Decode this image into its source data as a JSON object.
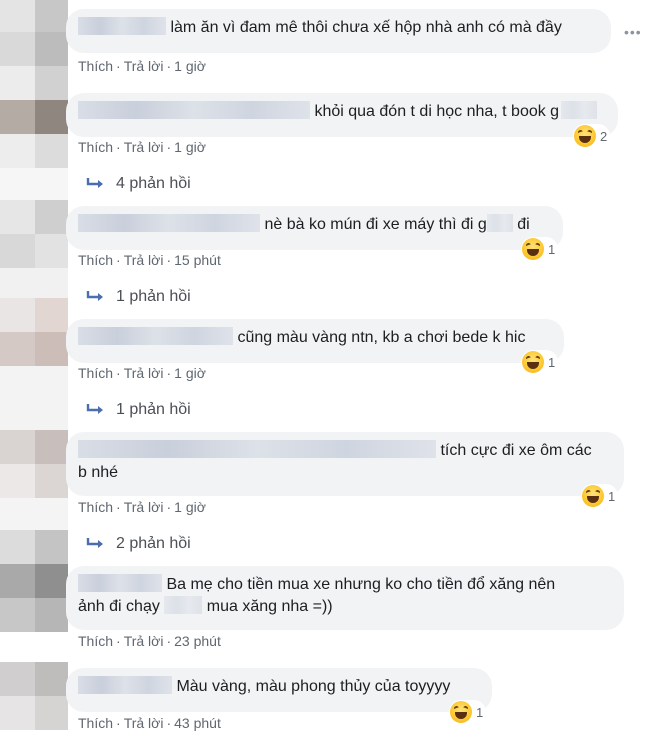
{
  "comments": [
    {
      "text": "làm ăn vì đam mê thôi chưa xế hộp nhà anh có mà đầy",
      "like": "Thích",
      "reply": "Trả lời",
      "time": "1 giờ"
    },
    {
      "text": "khỏi qua đón t di học nha, t book g",
      "like": "Thích",
      "reply": "Trả lời",
      "time": "1 giờ",
      "reactions": "2",
      "replies": "4 phản hồi"
    },
    {
      "text_a": "nè bà ko mún đi xe máy thì đi g",
      "text_b": "đi",
      "like": "Thích",
      "reply": "Trả lời",
      "time": "15 phút",
      "reactions": "1",
      "replies": "1 phản hồi"
    },
    {
      "text": "cũng màu vàng ntn, kb a chơi bede k hic",
      "like": "Thích",
      "reply": "Trả lời",
      "time": "1 giờ",
      "reactions": "1",
      "replies": "1 phản hồi"
    },
    {
      "text_line1": "tích cực đi xe ôm các",
      "text_line2": "b nhé",
      "like": "Thích",
      "reply": "Trả lời",
      "time": "1 giờ",
      "reactions": "1",
      "replies": "2 phản hồi"
    },
    {
      "text_line1": "Ba mẹ cho tiền mua xe nhưng ko cho tiền đổ xăng nên",
      "text_line2a": "ảnh đi chạy",
      "text_line2b": "mua xăng nha =))",
      "like": "Thích",
      "reply": "Trả lời",
      "time": "23 phút"
    },
    {
      "text": "Màu vàng, màu phong thủy của toyyyy",
      "like": "Thích",
      "reply": "Trả lời",
      "time": "43 phút",
      "reactions": "1"
    }
  ],
  "icons": {
    "reaction": "haha-icon",
    "reply_arrow": "reply-arrow-icon",
    "more": "more-options-icon"
  },
  "colors": {
    "bubble": "#f2f3f5",
    "meta": "#606770",
    "text": "#1c1e21"
  }
}
